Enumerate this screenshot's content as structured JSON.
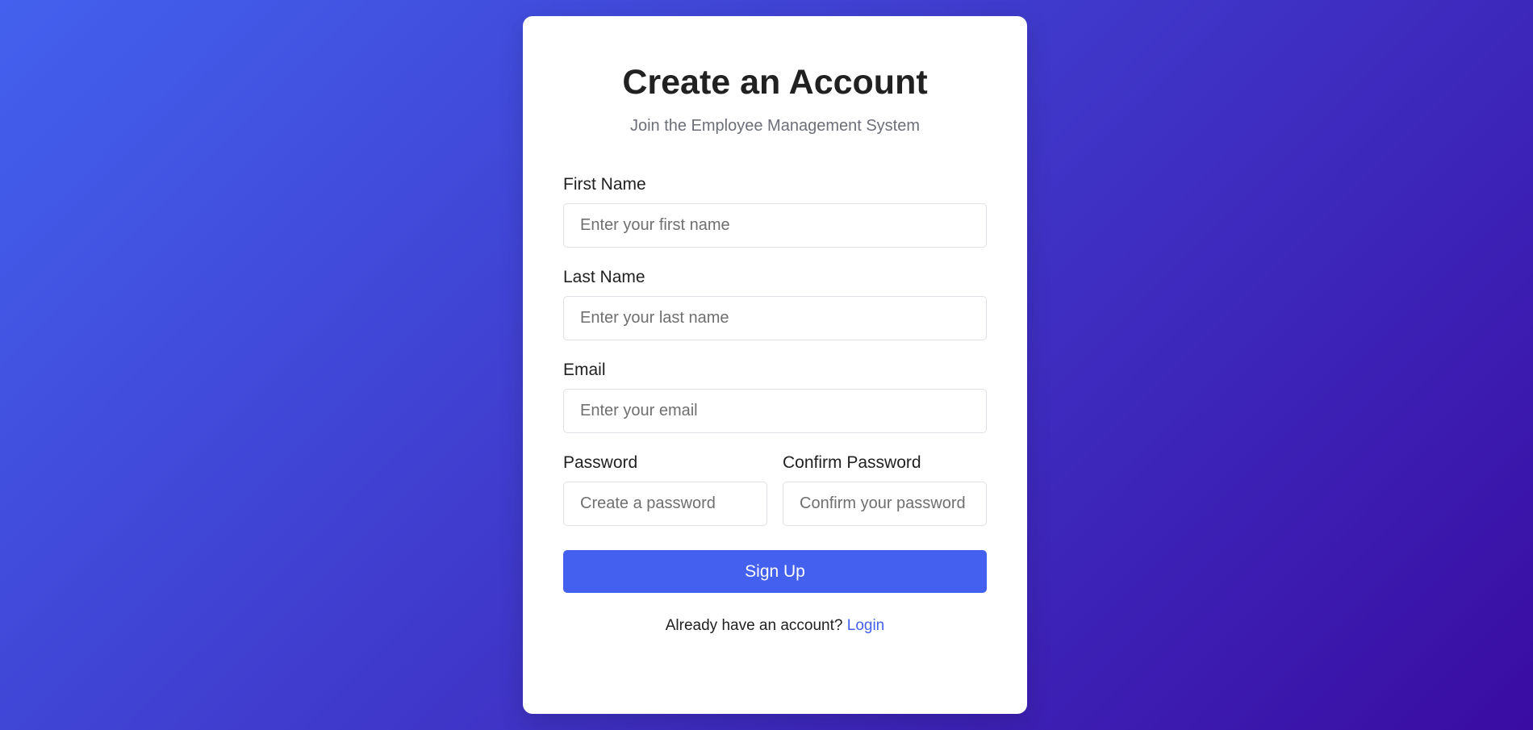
{
  "page": {
    "title": "Create an Account",
    "subtitle": "Join the Employee Management System"
  },
  "form": {
    "first_name": {
      "label": "First Name",
      "placeholder": "Enter your first name",
      "value": ""
    },
    "last_name": {
      "label": "Last Name",
      "placeholder": "Enter your last name",
      "value": ""
    },
    "email": {
      "label": "Email",
      "placeholder": "Enter your email",
      "value": ""
    },
    "password": {
      "label": "Password",
      "placeholder": "Create a password",
      "value": ""
    },
    "confirm_password": {
      "label": "Confirm Password",
      "placeholder": "Confirm your password",
      "value": ""
    },
    "submit_label": "Sign Up"
  },
  "footer": {
    "prompt": "Already have an account?",
    "link_label": "Login"
  },
  "colors": {
    "accent": "#4361ee",
    "background_start": "#4361ee",
    "background_end": "#3a0ca3",
    "card": "#ffffff",
    "text": "#212121",
    "muted": "#6c6f78"
  }
}
